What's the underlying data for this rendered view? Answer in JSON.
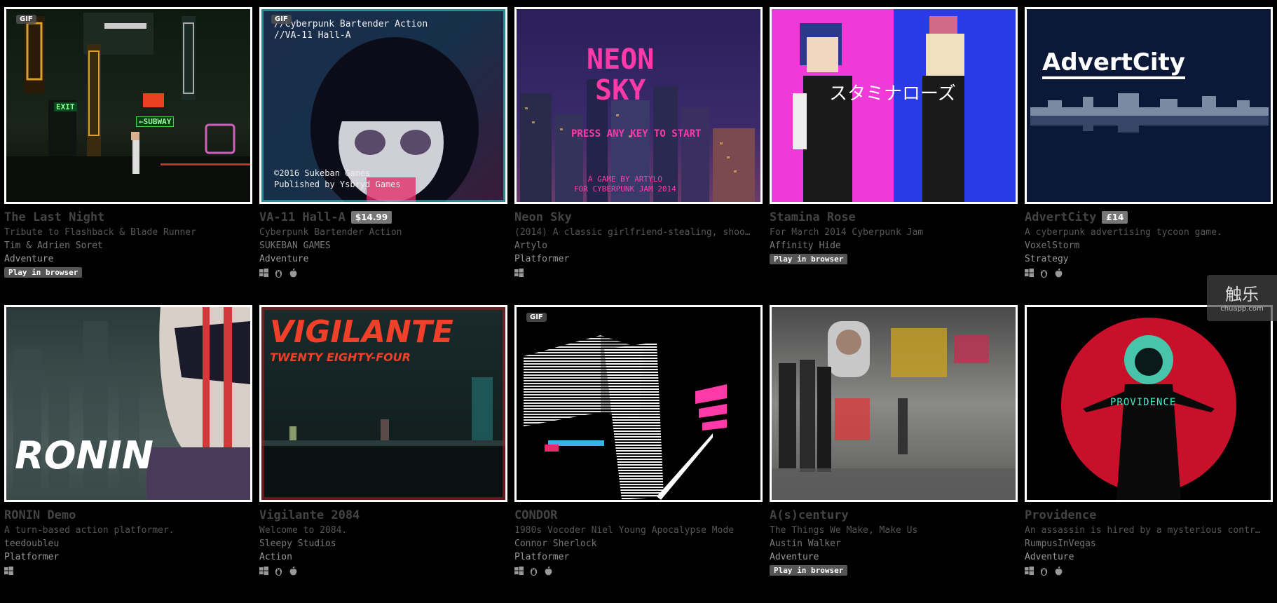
{
  "games": [
    {
      "title": "The Last Night",
      "price": "",
      "gif": true,
      "desc": "Tribute to Flashback & Blade Runner",
      "author": "Tim & Adrien Soret",
      "genre": "Adventure",
      "browser": "Play in browser",
      "platforms": []
    },
    {
      "title": "VA-11 Hall-A",
      "price": "$14.99",
      "gif": true,
      "desc": "Cyberpunk Bartender Action",
      "author": "SUKEBAN GAMES",
      "genre": "Adventure",
      "browser": "",
      "platforms": [
        "windows",
        "linux",
        "mac"
      ]
    },
    {
      "title": "Neon Sky",
      "price": "",
      "gif": false,
      "desc": "(2014) A classic girlfriend-stealing, shoo…",
      "author": "Artylo",
      "genre": "Platformer",
      "browser": "",
      "platforms": [
        "windows"
      ]
    },
    {
      "title": "Stamina Rose",
      "price": "",
      "gif": false,
      "desc": "For March 2014 Cyberpunk Jam",
      "author": "Affinity Hide",
      "genre": "",
      "browser": "Play in browser",
      "platforms": []
    },
    {
      "title": "AdvertCity",
      "price": "£14",
      "gif": false,
      "desc": "A cyberpunk advertising tycoon game.",
      "author": "VoxelStorm",
      "genre": "Strategy",
      "browser": "",
      "platforms": [
        "windows",
        "linux",
        "mac"
      ]
    },
    {
      "title": "RONIN Demo",
      "price": "",
      "gif": false,
      "desc": "A turn-based action platformer.",
      "author": "teedoubleu",
      "genre": "Platformer",
      "browser": "",
      "platforms": [
        "windows"
      ]
    },
    {
      "title": "Vigilante 2084",
      "price": "",
      "gif": false,
      "desc": "Welcome to 2084.",
      "author": "Sleepy Studios",
      "genre": "Action",
      "browser": "",
      "platforms": [
        "windows",
        "linux",
        "mac"
      ]
    },
    {
      "title": "CONDOR",
      "price": "",
      "gif": true,
      "desc": "1980s Vocoder Niel Young Apocalypse Mode",
      "author": "Connor Sherlock",
      "genre": "Platformer",
      "browser": "",
      "platforms": [
        "windows",
        "linux",
        "mac"
      ]
    },
    {
      "title": "A(s)century",
      "price": "",
      "gif": false,
      "desc": "The Things We Make, Make Us",
      "author": "Austin Walker",
      "genre": "Adventure",
      "browser": "Play in browser",
      "platforms": []
    },
    {
      "title": "Providence",
      "price": "",
      "gif": false,
      "desc": "An assassin is hired by a mysterious contr…",
      "author": "RumpusInVegas",
      "genre": "Adventure",
      "browser": "",
      "platforms": [
        "windows",
        "linux",
        "mac"
      ]
    }
  ],
  "thumb_text": {
    "gif": "GIF",
    "lastnight_exit": "EXIT",
    "lastnight_subway": "←SUBWAY",
    "va11_top": "//Cyberpunk Bartender Action\n//VA-11 Hall-A",
    "va11_bottom": "©2016 Sukeban Games\nPublished by Ysbryd Games",
    "neonsky_title": "NEON\nSKY",
    "neonsky_press": "PRESS ANY KEY TO START",
    "neonsky_credit": "A GAME BY ARTYLO\nFOR CYBERPUNK JAM 2014",
    "stamina_title": "スタミナローズ",
    "advert_title": "AdvertCity",
    "ronin_title": "RONIN",
    "vigilante_title": "VIGILANTE",
    "vigilante_sub": "TWENTY EIGHTY-FOUR",
    "providence_title": "PROVIDENCE"
  },
  "watermark": {
    "main": "触乐",
    "sub": "chuapp.com"
  }
}
